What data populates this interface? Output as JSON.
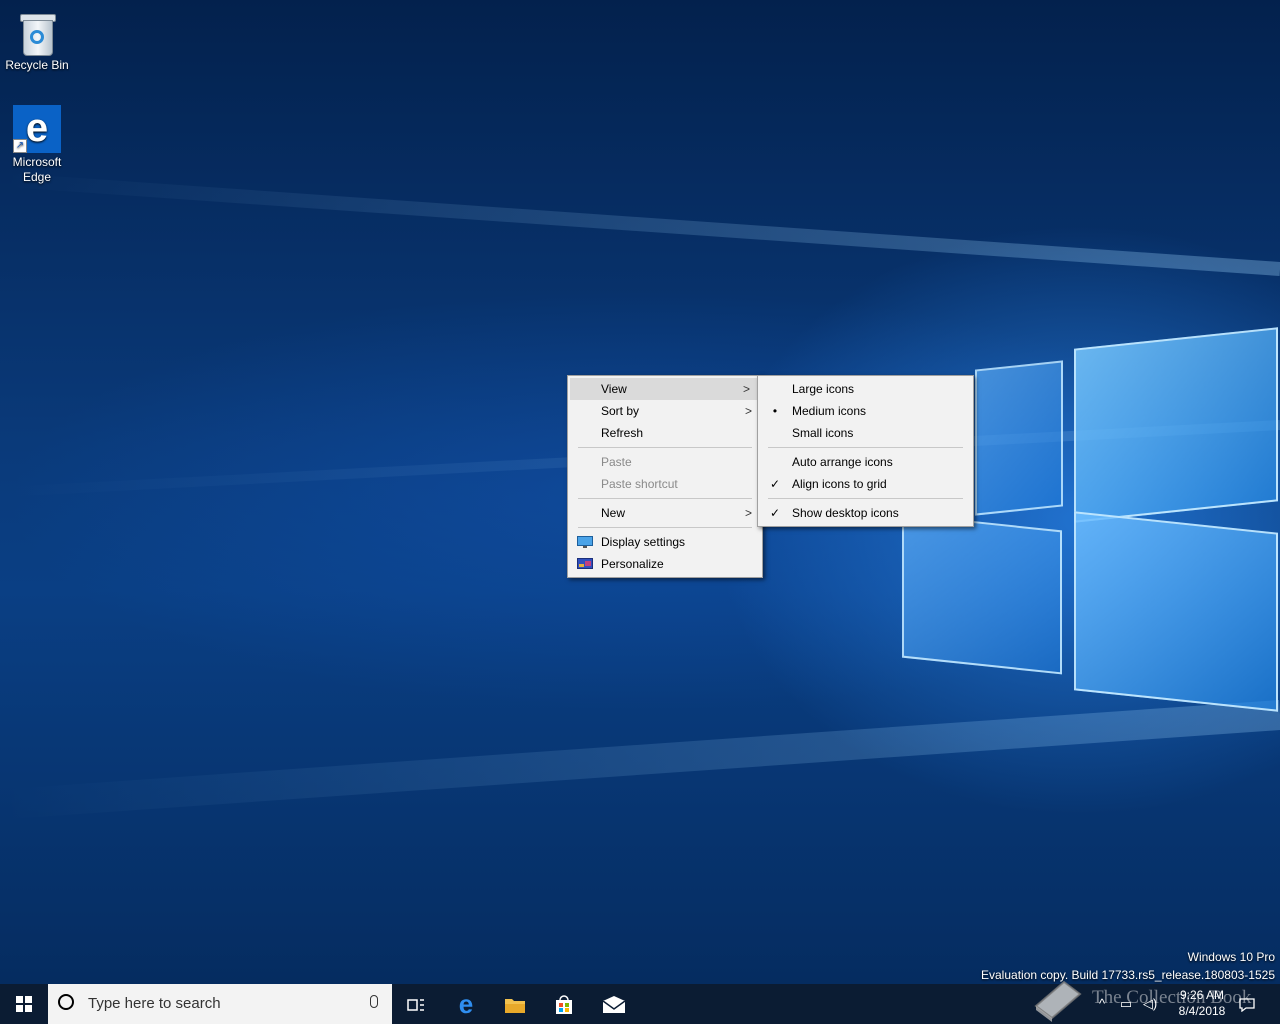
{
  "desktop": {
    "icons": [
      {
        "label": "Recycle Bin",
        "icon": "recycle-bin-icon"
      },
      {
        "label": "Microsoft\nEdge",
        "icon": "edge-icon"
      }
    ],
    "watermark": {
      "line1": "Windows 10 Pro",
      "line2": "Evaluation copy. Build 17733.rs5_release.180803-1525"
    }
  },
  "context_menu": {
    "items": [
      {
        "label": "View",
        "submenu": true,
        "highlighted": true
      },
      {
        "label": "Sort by",
        "submenu": true
      },
      {
        "label": "Refresh"
      },
      {
        "label": "Paste",
        "disabled": true
      },
      {
        "label": "Paste shortcut",
        "disabled": true
      },
      {
        "label": "New",
        "submenu": true
      },
      {
        "label": "Display settings",
        "icon": "display-settings-icon"
      },
      {
        "label": "Personalize",
        "icon": "personalize-icon"
      }
    ],
    "arrow": ">"
  },
  "view_submenu": {
    "items": [
      {
        "label": "Large icons"
      },
      {
        "label": "Medium icons",
        "mark": "•"
      },
      {
        "label": "Small icons"
      },
      {
        "label": "Auto arrange icons"
      },
      {
        "label": "Align icons to grid",
        "mark": "✓"
      },
      {
        "label": "Show desktop icons",
        "mark": "✓"
      }
    ]
  },
  "taskbar": {
    "search_placeholder": "Type here to search",
    "pinned": [
      "task-view-icon",
      "edge-icon",
      "file-explorer-icon",
      "store-icon",
      "mail-icon"
    ],
    "clock": {
      "time": "9:26 AM",
      "date": "8/4/2018"
    },
    "overlay_text": "The Collection Book"
  },
  "colors": {
    "taskbar": "#0b1c33",
    "menu_bg": "#f2f2f2",
    "highlight": "#dadada"
  }
}
